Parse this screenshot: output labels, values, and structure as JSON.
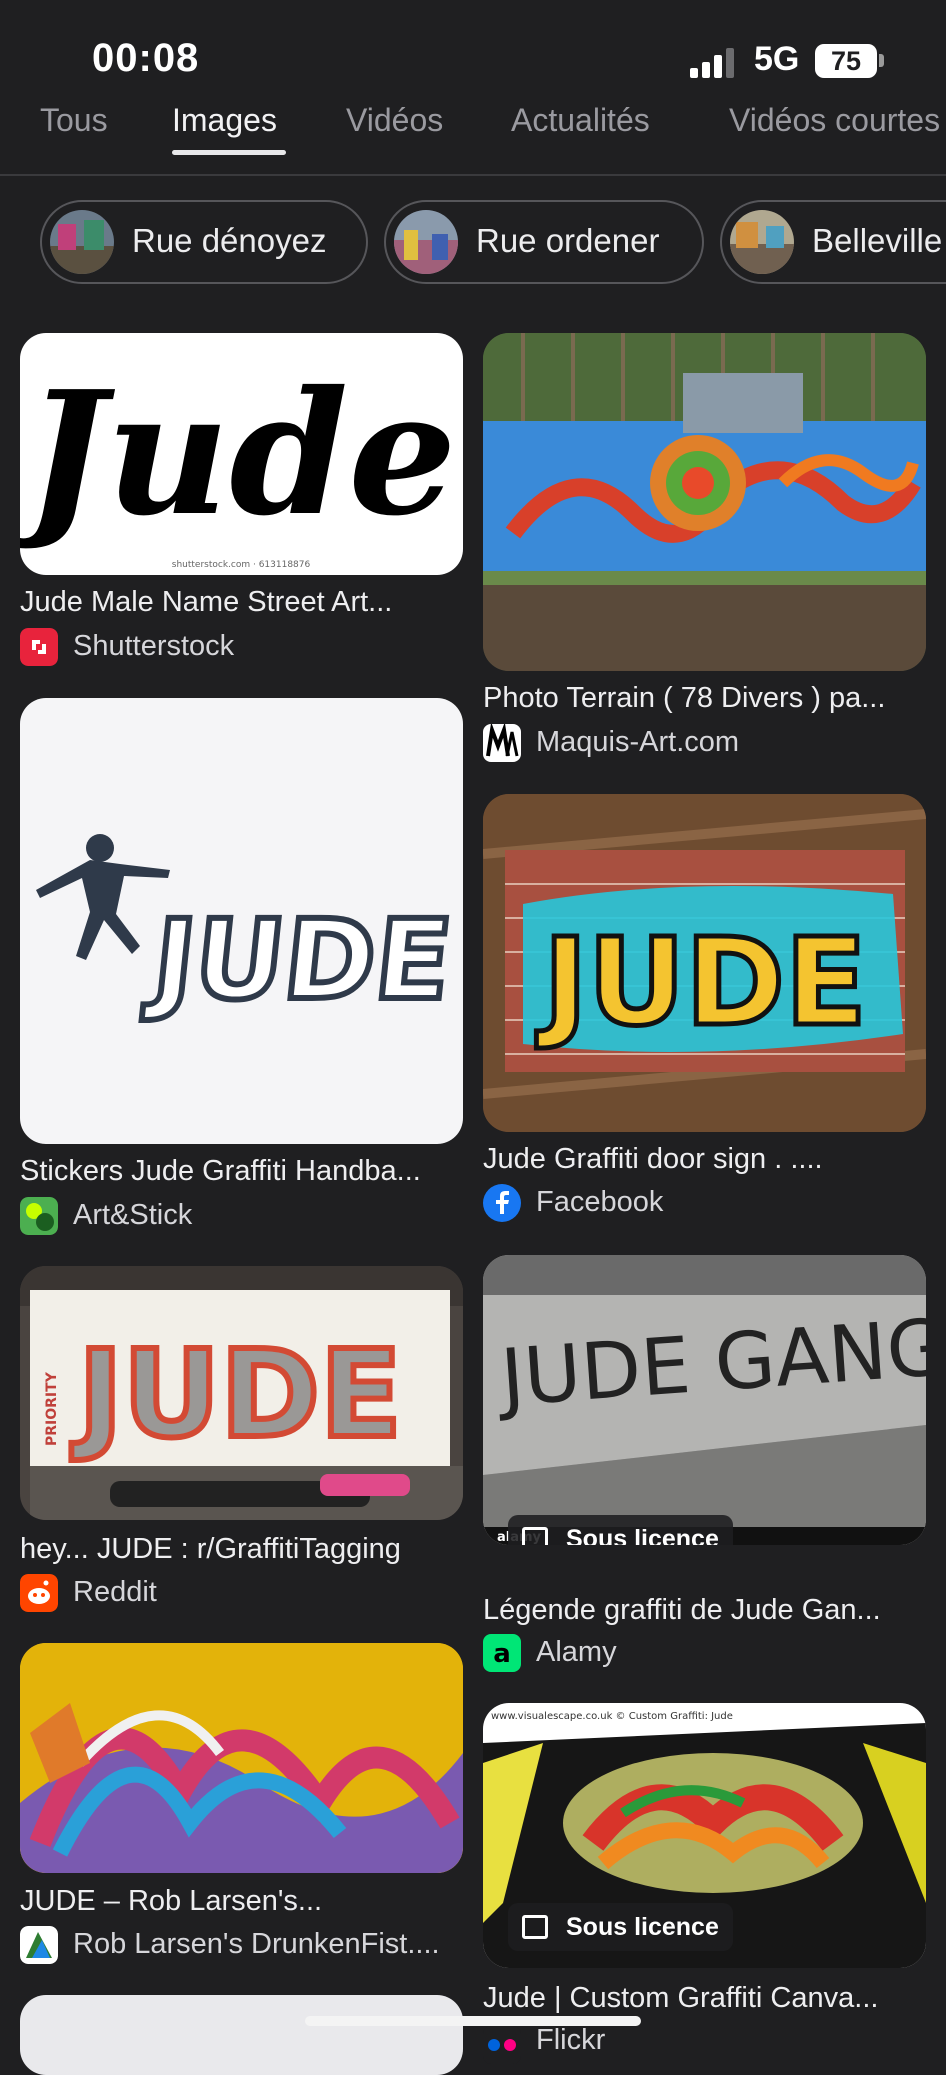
{
  "status": {
    "time": "00:08",
    "network": "5G",
    "battery": "75"
  },
  "tabs": [
    {
      "label": "Tous"
    },
    {
      "label": "Images",
      "active": true
    },
    {
      "label": "Vidéos"
    },
    {
      "label": "Actualités"
    },
    {
      "label": "Vidéos courtes"
    }
  ],
  "chips": [
    {
      "label": "Rue dénoyez"
    },
    {
      "label": "Rue ordener"
    },
    {
      "label": "Belleville"
    }
  ],
  "results": [
    {
      "title": "Jude Male Name Street Art...",
      "source": "Shutterstock",
      "favicon_color": "#e8233c",
      "image_text": "Jude",
      "image_caption": "shutterstock.com · 613118876"
    },
    {
      "title": "Photo Terrain ( 78 Divers ) pa...",
      "source": "Maquis-Art.com",
      "favicon_color": "#ffffff"
    },
    {
      "title": "Stickers Jude Graffiti Handba...",
      "source": "Art&Stick",
      "favicon_color": "#4caf50",
      "image_text": "JUDE"
    },
    {
      "title": "Jude Graffiti door sign . ....",
      "source": "Facebook",
      "favicon_color": "#1877f2",
      "image_text": "JUDE"
    },
    {
      "title": "hey... JUDE : r/GraffitiTagging",
      "source": "Reddit",
      "favicon_color": "#ff4500",
      "image_text": "JUDE",
      "image_caption": "PRIORITY"
    },
    {
      "title": "Légende graffiti de Jude Gan...",
      "source": "Alamy",
      "favicon_color": "#00c853",
      "licence": "Sous licence",
      "image_text": "JUDE GANG",
      "image_caption": "alamy"
    },
    {
      "title": "JUDE – Rob Larsen's...",
      "source": "Rob Larsen's DrunkenFist....",
      "favicon_color": "#2e7d32"
    },
    {
      "title": "Jude | Custom Graffiti Canva...",
      "source": "Flickr",
      "favicon_color": "#0063dc",
      "licence": "Sous licence",
      "image_caption": "www.visualescape.co.uk © Custom Graffiti: Jude"
    }
  ]
}
